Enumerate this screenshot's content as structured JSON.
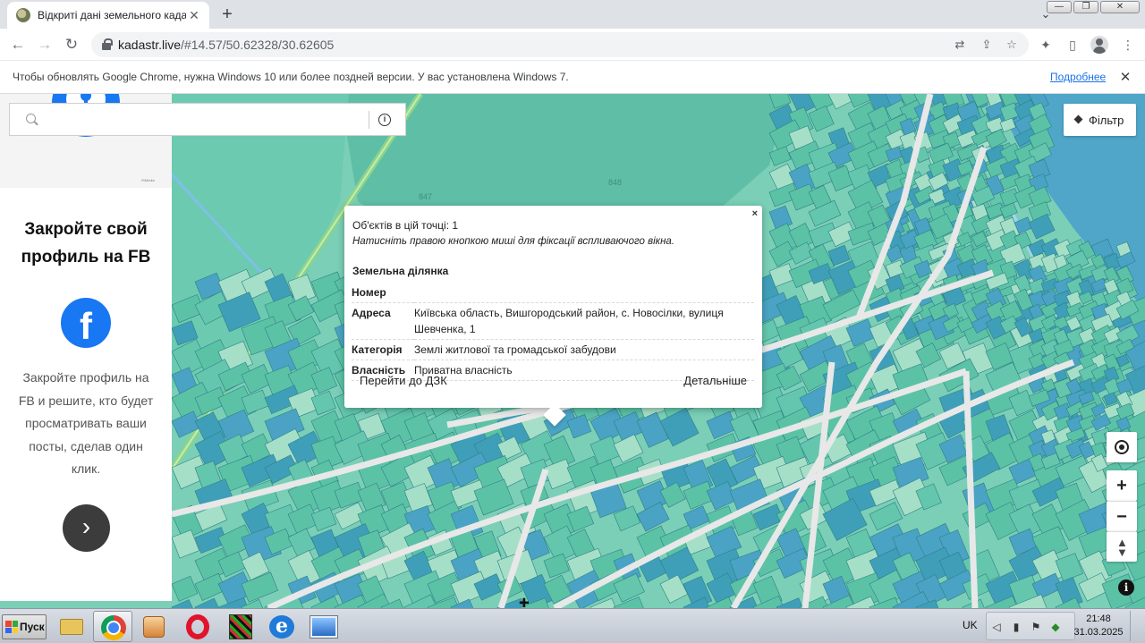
{
  "browser": {
    "tab_title": "Відкриті дані земельного кадастру",
    "new_tab_label": "+",
    "url_host": "kadastr.live",
    "url_path": "/#14.57/50.62328/30.62605",
    "infobar_text": "Чтобы обновлять Google Chrome, нужна Windows 10 или более поздней версии. У вас установлена Windows 7.",
    "infobar_link": "Подробнее"
  },
  "ad": {
    "brand": "ISMedia",
    "headline_1": "Закройте свой",
    "headline_2": "профиль на FB",
    "body_1": "Закройте профиль на",
    "body_2": "FB и решите, кто будет",
    "body_3": "просматривать ваши",
    "body_4": "посты, сделав один",
    "body_5": "клик."
  },
  "search": {
    "placeholder": ""
  },
  "filter": {
    "label": "Фільтр"
  },
  "map_labels": {
    "label_847": "847",
    "label_848": "848"
  },
  "popup": {
    "count": "Об'єктів в цій точці: 1",
    "hint": "Натисніть правою кнопкою миші для фіксації вспливаючого вікна.",
    "section": "Земельна ділянка",
    "rows": [
      {
        "key": "Номер",
        "value": ""
      },
      {
        "key": "Адреса",
        "value": "Київська область, Вишгородський район, с. Новосілки, вулиця Шевченка, 1"
      },
      {
        "key": "Категорія",
        "value": "Землі житлової та громадської забудови"
      },
      {
        "key": "Власність",
        "value": "Приватна власність"
      }
    ],
    "action_left": "Перейти до ДЗК",
    "action_right": "Детальніше",
    "close": "×"
  },
  "map_controls": {
    "zoom_in": "+",
    "zoom_out": "−",
    "info": "i"
  },
  "taskbar": {
    "start_label": "Пуск",
    "language": "UK",
    "time": "21:48",
    "date": "31.03.2025"
  },
  "colors": {
    "map_base": "#6fc9b0",
    "parcel_teal": "#5cc2a6",
    "parcel_blue": "#4aa3c4",
    "parcel_light": "#a6dfc7",
    "road": "#e8e8e8",
    "water": "#4fa6c9",
    "facebook_blue": "#1877f2"
  }
}
